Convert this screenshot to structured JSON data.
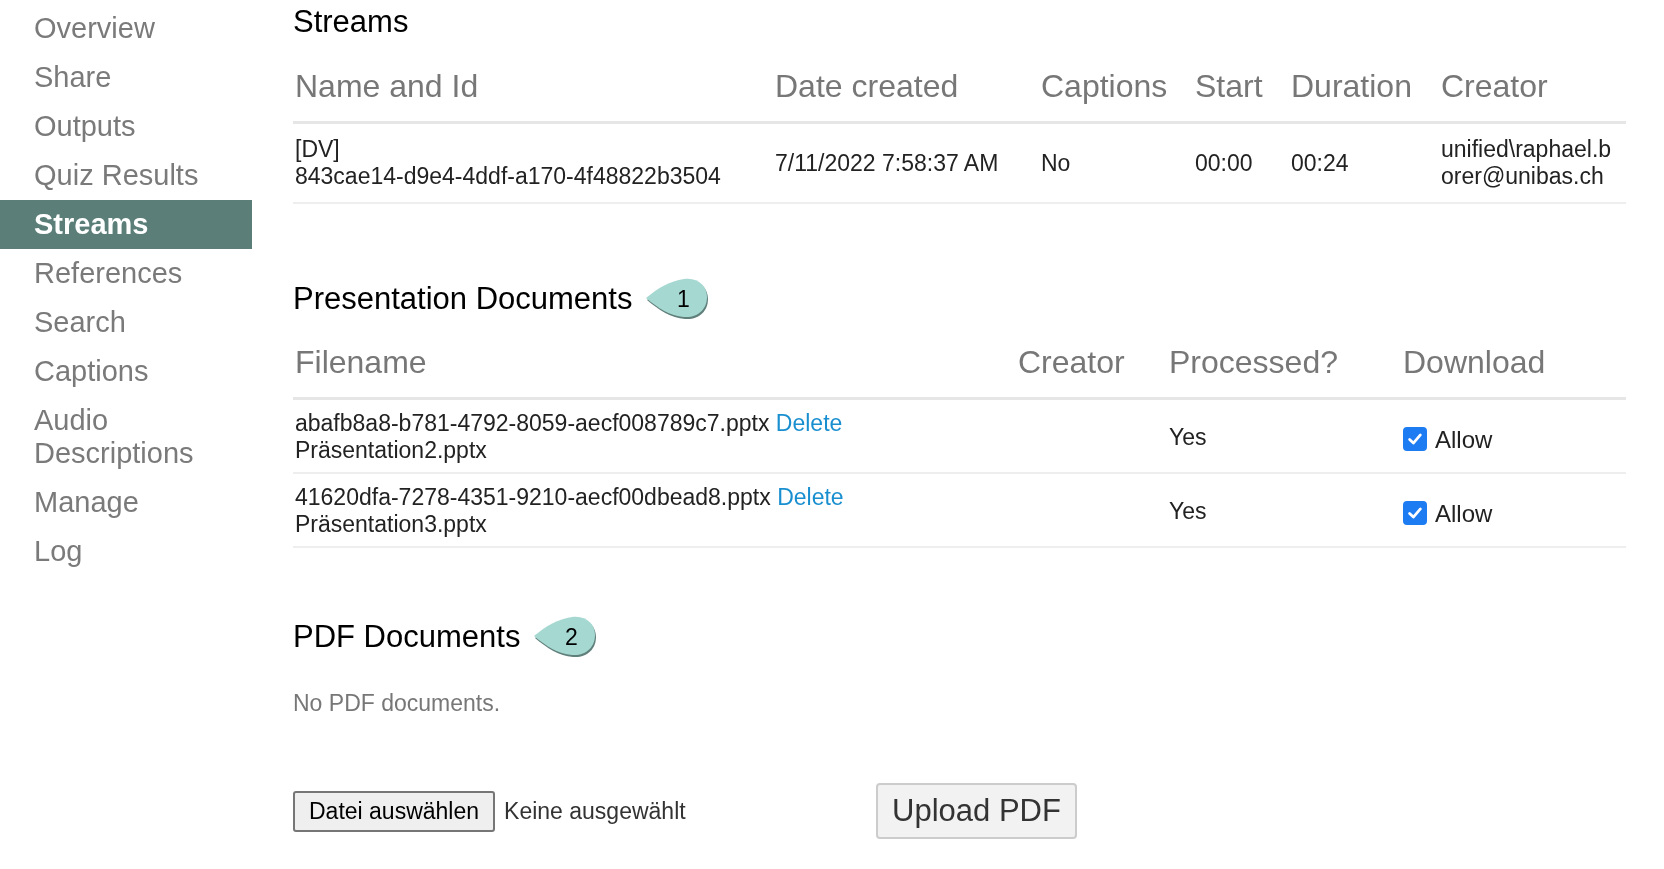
{
  "sidebar": {
    "items": [
      {
        "label": "Overview",
        "selected": false
      },
      {
        "label": "Share",
        "selected": false
      },
      {
        "label": "Outputs",
        "selected": false
      },
      {
        "label": "Quiz Results",
        "selected": false
      },
      {
        "label": "Streams",
        "selected": true
      },
      {
        "label": "References",
        "selected": false
      },
      {
        "label": "Search",
        "selected": false
      },
      {
        "label": "Captions",
        "selected": false
      },
      {
        "label": "Audio Descriptions",
        "selected": false
      },
      {
        "label": "Manage",
        "selected": false
      },
      {
        "label": "Log",
        "selected": false
      }
    ]
  },
  "streams": {
    "title": "Streams",
    "columns": [
      "Name and Id",
      "Date created",
      "Captions",
      "Start",
      "Duration",
      "Creator"
    ],
    "rows": [
      {
        "name": "[DV]",
        "id": "843cae14-d9e4-4ddf-a170-4f48822b3504",
        "date_created": "7/11/2022 7:58:37 AM",
        "captions": "No",
        "start": "00:00",
        "duration": "00:24",
        "creator": "unified\\raphael.borer@unibas.ch"
      }
    ]
  },
  "presentation_documents": {
    "title": "Presentation Documents",
    "badge": "1",
    "columns": [
      "Filename",
      "Creator",
      "Processed?",
      "Download"
    ],
    "rows": [
      {
        "file": "abafb8a8-b781-4792-8059-aecf008789c7.pptx",
        "delete_link": "Delete",
        "original_name": "Präsentation2.pptx",
        "processed": "Yes",
        "download": {
          "checked": true,
          "label": "Allow"
        }
      },
      {
        "file": "41620dfa-7278-4351-9210-aecf00dbead8.pptx",
        "delete_link": "Delete",
        "original_name": "Präsentation3.pptx",
        "processed": "Yes",
        "download": {
          "checked": true,
          "label": "Allow"
        }
      }
    ]
  },
  "pdf_documents": {
    "title": "PDF Documents",
    "badge": "2",
    "empty_message": "No PDF documents.",
    "file_button": "Datei auswählen",
    "file_status": "Keine ausgewählt",
    "upload_button": "Upload PDF"
  }
}
